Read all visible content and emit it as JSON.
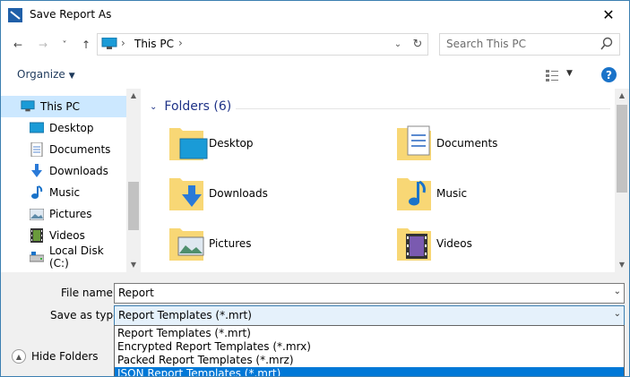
{
  "window": {
    "title": "Save Report As"
  },
  "nav": {
    "back": "←",
    "forward": "→",
    "recent": "˅",
    "up": "↑",
    "address": "This PC",
    "search_placeholder": "Search This PC"
  },
  "toolbar": {
    "organize_label": "Organize",
    "help_label": "?"
  },
  "sidebar": {
    "items": [
      {
        "label": "This PC",
        "icon": "pc-icon",
        "selected": true
      },
      {
        "label": "Desktop",
        "icon": "desktop-icon"
      },
      {
        "label": "Documents",
        "icon": "documents-icon"
      },
      {
        "label": "Downloads",
        "icon": "downloads-icon"
      },
      {
        "label": "Music",
        "icon": "music-icon"
      },
      {
        "label": "Pictures",
        "icon": "pictures-icon"
      },
      {
        "label": "Videos",
        "icon": "videos-icon"
      },
      {
        "label": "Local Disk (C:)",
        "icon": "drive-icon"
      }
    ]
  },
  "content": {
    "group_header": "Folders (6)",
    "folders": [
      {
        "label": "Desktop",
        "icon": "desktop-folder-icon"
      },
      {
        "label": "Documents",
        "icon": "documents-folder-icon"
      },
      {
        "label": "Downloads",
        "icon": "downloads-folder-icon"
      },
      {
        "label": "Music",
        "icon": "music-folder-icon"
      },
      {
        "label": "Pictures",
        "icon": "pictures-folder-icon"
      },
      {
        "label": "Videos",
        "icon": "videos-folder-icon"
      }
    ]
  },
  "form": {
    "file_name_label": "File name:",
    "file_name_value": "Report",
    "save_type_label": "Save as type:",
    "save_type_value": "Report Templates (*.mrt)",
    "type_options": [
      "Report Templates (*.mrt)",
      "Encrypted Report Templates (*.mrx)",
      "Packed Report Templates (*.mrz)",
      "JSON Report Templates (*.mrt)"
    ],
    "highlighted_option_index": 3
  },
  "footer": {
    "hide_folders_label": "Hide Folders"
  },
  "colors": {
    "accent": "#0078d7",
    "selection": "#cce8ff",
    "header_blue": "#1e3287"
  }
}
